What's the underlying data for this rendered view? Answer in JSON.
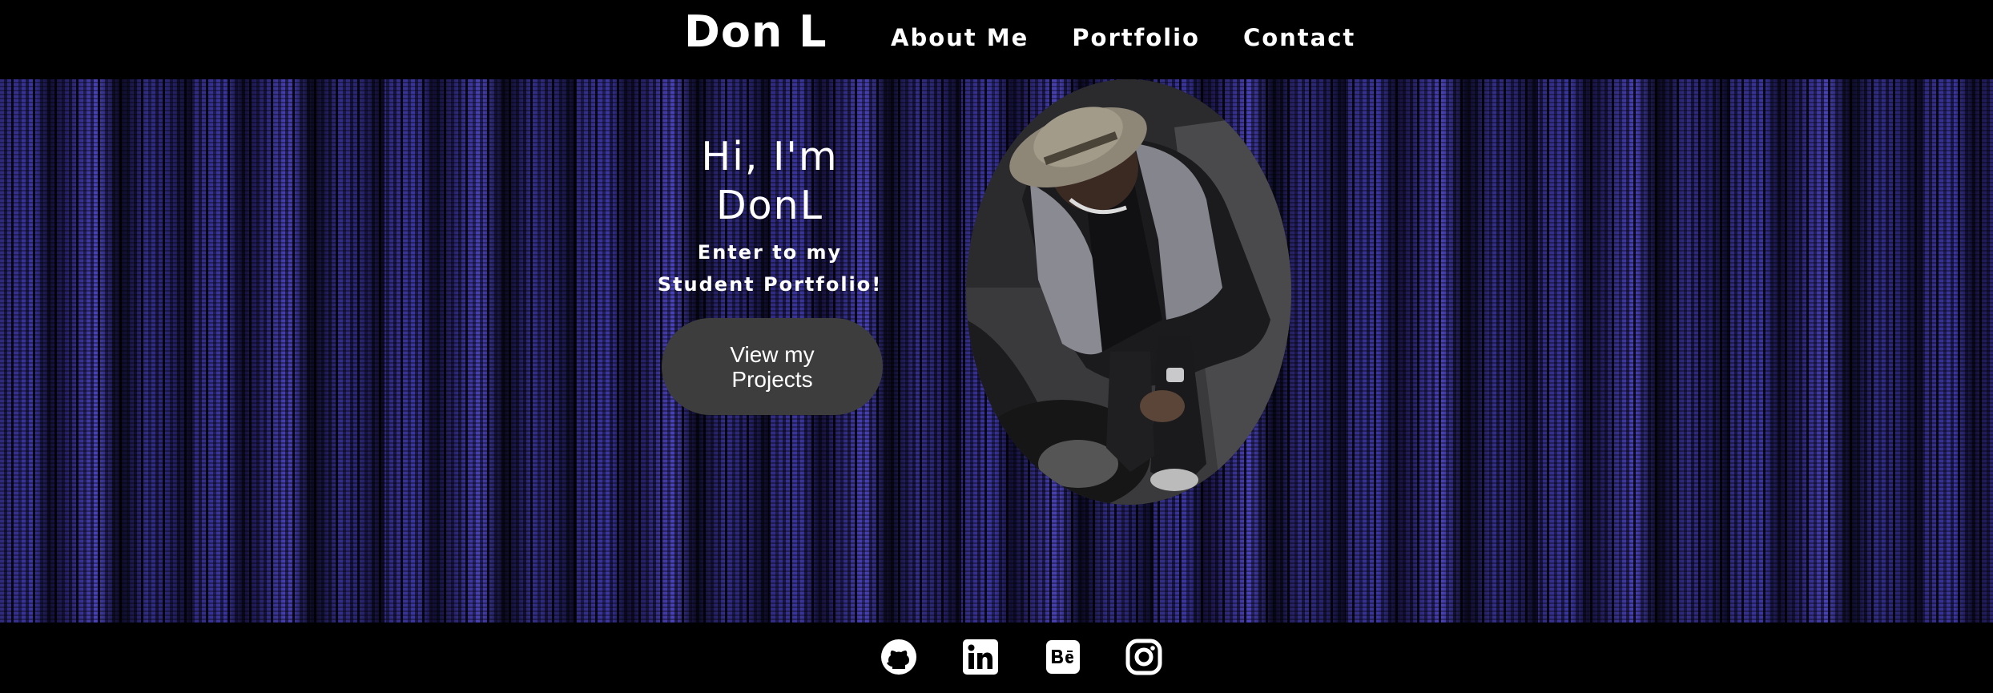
{
  "header": {
    "brand": "Don L",
    "nav": [
      {
        "label": "About Me"
      },
      {
        "label": "Portfolio"
      },
      {
        "label": "Contact"
      }
    ]
  },
  "hero": {
    "title_line1": "Hi, I'm",
    "title_line2": "DonL",
    "subtitle_line1": "Enter to my",
    "subtitle_line2": "Student Portfolio!",
    "cta_label": "View my Projects"
  },
  "footer": {
    "social": [
      {
        "icon": "github-icon"
      },
      {
        "icon": "linkedin-icon"
      },
      {
        "icon": "behance-icon"
      },
      {
        "icon": "instagram-icon"
      }
    ]
  },
  "colors": {
    "background": "#000000",
    "hero_accent": "#3b36a0",
    "button_bg": "#3d3d3d",
    "text": "#ffffff"
  }
}
